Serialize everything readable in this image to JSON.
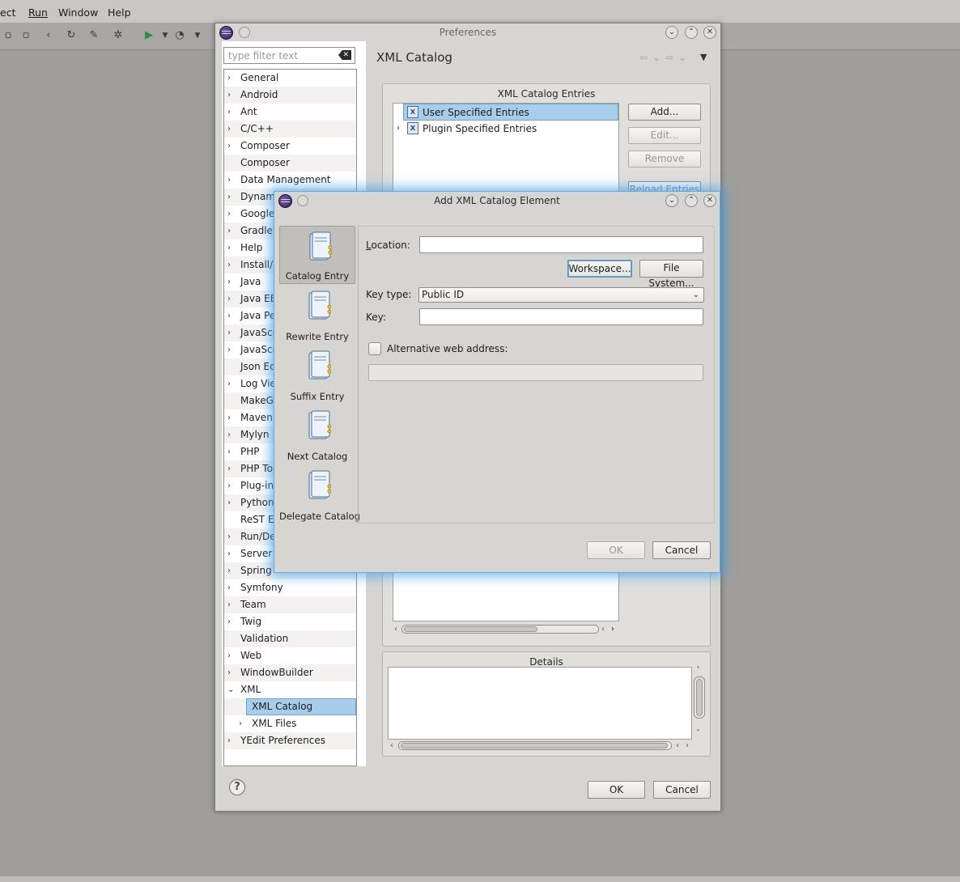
{
  "ide": {
    "menu": [
      "ect",
      "Run",
      "Window",
      "Help"
    ]
  },
  "preferences": {
    "title": "Preferences",
    "filter_placeholder": "type filter text",
    "tree": [
      {
        "label": "General",
        "expandable": true
      },
      {
        "label": "Android",
        "expandable": true
      },
      {
        "label": "Ant",
        "expandable": true
      },
      {
        "label": "C/C++",
        "expandable": true
      },
      {
        "label": "Composer",
        "expandable": true
      },
      {
        "label": "Composer",
        "expandable": false
      },
      {
        "label": "Data Management",
        "expandable": true
      },
      {
        "label": "Dynami",
        "expandable": true
      },
      {
        "label": "Google",
        "expandable": true
      },
      {
        "label": "Gradle",
        "expandable": true
      },
      {
        "label": "Help",
        "expandable": true
      },
      {
        "label": "Install/",
        "expandable": true
      },
      {
        "label": "Java",
        "expandable": true
      },
      {
        "label": "Java EE",
        "expandable": true
      },
      {
        "label": "Java Pe",
        "expandable": true
      },
      {
        "label": "JavaScr",
        "expandable": true
      },
      {
        "label": "JavaScr",
        "expandable": true
      },
      {
        "label": "Json Ec",
        "expandable": false
      },
      {
        "label": "Log Vie",
        "expandable": true
      },
      {
        "label": "MakeGo",
        "expandable": false
      },
      {
        "label": "Maven",
        "expandable": true
      },
      {
        "label": "Mylyn",
        "expandable": true
      },
      {
        "label": "PHP",
        "expandable": true
      },
      {
        "label": "PHP Too",
        "expandable": true
      },
      {
        "label": "Plug-in",
        "expandable": true
      },
      {
        "label": "Python",
        "expandable": true
      },
      {
        "label": "ReST Ed",
        "expandable": false
      },
      {
        "label": "Run/De",
        "expandable": true
      },
      {
        "label": "Server",
        "expandable": true
      },
      {
        "label": "Spring",
        "expandable": true
      },
      {
        "label": "Symfony",
        "expandable": true
      },
      {
        "label": "Team",
        "expandable": true
      },
      {
        "label": "Twig",
        "expandable": true
      },
      {
        "label": "Validation",
        "expandable": false
      },
      {
        "label": "Web",
        "expandable": true
      },
      {
        "label": "WindowBuilder",
        "expandable": true
      },
      {
        "label": "XML",
        "expandable": true,
        "expanded": true
      },
      {
        "label": "XML Catalog",
        "expandable": false,
        "child": true,
        "selected": true
      },
      {
        "label": "XML Files",
        "expandable": true,
        "child": true
      },
      {
        "label": "YEdit Preferences",
        "expandable": true
      }
    ],
    "page_title": "XML Catalog",
    "catalog_entries_title": "XML Catalog Entries",
    "entries": [
      {
        "label": "User Specified Entries",
        "selected": true,
        "expandable": false
      },
      {
        "label": "Plugin Specified Entries",
        "selected": false,
        "expandable": true
      }
    ],
    "buttons": {
      "add": "Add...",
      "edit": "Edit...",
      "remove": "Remove",
      "reload": "Reload Entries"
    },
    "details_title": "Details",
    "ok": "OK",
    "cancel": "Cancel"
  },
  "dialog": {
    "title": "Add XML Catalog Element",
    "sidebar": [
      {
        "label": "Catalog Entry",
        "selected": true,
        "icon": "catalog-entry-icon"
      },
      {
        "label": "Rewrite Entry",
        "selected": false,
        "icon": "rewrite-entry-icon"
      },
      {
        "label": "Suffix Entry",
        "selected": false,
        "icon": "suffix-entry-icon"
      },
      {
        "label": "Next Catalog",
        "selected": false,
        "icon": "next-catalog-icon"
      },
      {
        "label": "Delegate Catalog",
        "selected": false,
        "icon": "delegate-catalog-icon"
      }
    ],
    "location_label": "Location:",
    "location_value": "",
    "workspace_button": "Workspace...",
    "file_system_button": "File System...",
    "key_type_label": "Key type:",
    "key_type_value": "Public ID",
    "key_label": "Key:",
    "key_value": "",
    "alt_web_label": "Alternative web address:",
    "alt_web_value": "",
    "alt_web_checked": false,
    "ok": "OK",
    "cancel": "Cancel"
  },
  "colors": {
    "accent": "#a8cdea",
    "glow": "#40a0eb",
    "window_bg": "#d7d5d2"
  }
}
